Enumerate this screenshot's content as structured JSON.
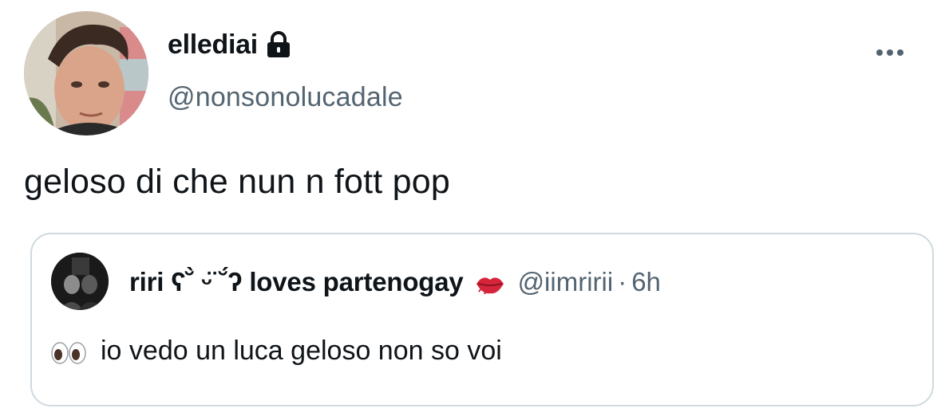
{
  "tweet": {
    "display_name": "ellediai",
    "handle": "@nonsonolucadale",
    "text": "geloso di che nun n fott pop",
    "verified_icon": "lock-icon",
    "menu_icon": "more-dots-icon"
  },
  "quote": {
    "display_name": "riri ʕ˘̀ ᵕ̈ ˘́ʔ loves partenogay",
    "name_emoji": "kiss-mark-lips-icon",
    "handle": "@iimririi",
    "separator": "·",
    "time": "6h",
    "body_emoji": "eyes-icon",
    "text": "io vedo un luca geloso non so voi"
  },
  "colors": {
    "text": "#0f1419",
    "secondary": "#536471",
    "border": "#cfd9de",
    "background": "#ffffff"
  }
}
